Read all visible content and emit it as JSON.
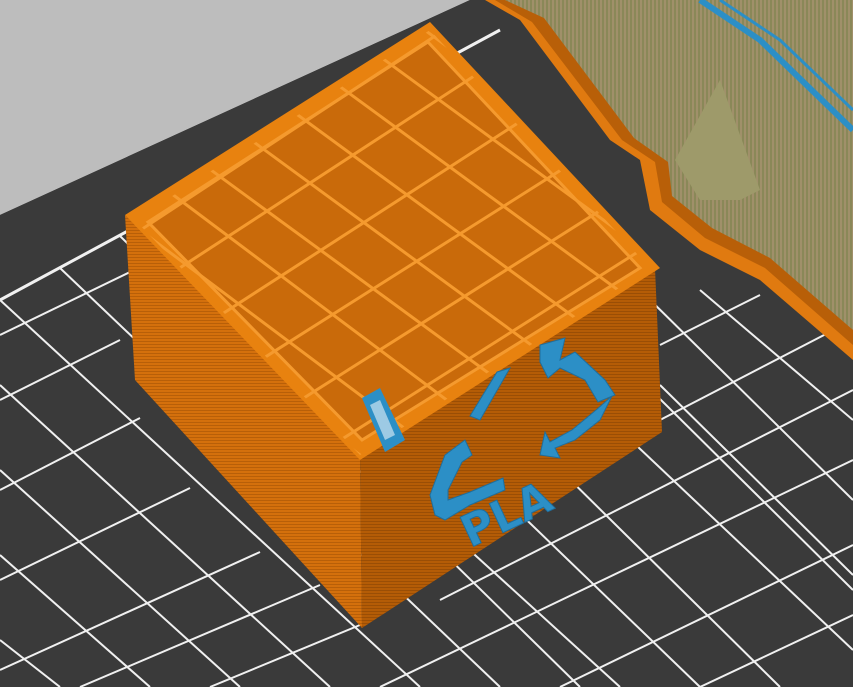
{
  "scene": {
    "label_text": "PLA",
    "logo_icon": "recycle-icon",
    "colors": {
      "background": "#bdbdbd",
      "bed": "#3a3a3a",
      "grid_line": "#f2f2f2",
      "perimeter": "#e07a10",
      "perimeter_shade": "#a95808",
      "infill": "#d97612",
      "infill_line": "#f59a2e",
      "label_blue": "#2c8fc6",
      "support": "#8e8a5a"
    }
  }
}
